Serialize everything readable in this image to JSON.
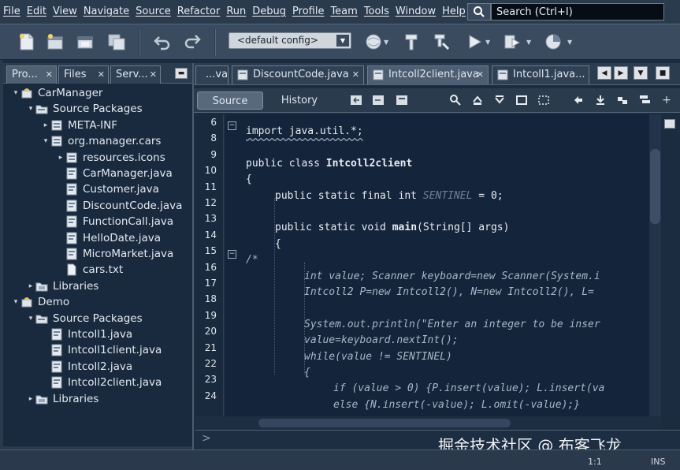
{
  "menu": [
    "File",
    "Edit",
    "View",
    "Navigate",
    "Source",
    "Refactor",
    "Run",
    "Debug",
    "Profile",
    "Team",
    "Tools",
    "Window",
    "Help"
  ],
  "search": {
    "placeholder": "Search (Ctrl+I)"
  },
  "toolbar": {
    "config": "<default config>",
    "icons": [
      "new-file-icon",
      "new-project-icon",
      "open-project-icon",
      "save-all-icon",
      "undo-icon",
      "redo-icon",
      "config-dropdown",
      "clean-build-icon",
      "build-hammer-icon",
      "clean-build-broom-icon",
      "run-icon",
      "debug-icon",
      "profile-icon"
    ]
  },
  "left_panel": {
    "tabs": [
      "Pro...",
      "Files",
      "Serv..."
    ],
    "tree": [
      {
        "label": "CarManager",
        "kind": "project",
        "expanded": true
      },
      {
        "label": "Source Packages",
        "kind": "source-folder",
        "expanded": true
      },
      {
        "label": "META-INF",
        "kind": "package",
        "expanded": false
      },
      {
        "label": "org.manager.cars",
        "kind": "package",
        "expanded": true
      },
      {
        "label": "resources.icons",
        "kind": "package",
        "expanded": false
      },
      {
        "label": "CarManager.java",
        "kind": "java-file"
      },
      {
        "label": "Customer.java",
        "kind": "java-file"
      },
      {
        "label": "DiscountCode.java",
        "kind": "java-file"
      },
      {
        "label": "FunctionCall.java",
        "kind": "java-file"
      },
      {
        "label": "HelloDate.java",
        "kind": "java-file"
      },
      {
        "label": "MicroMarket.java",
        "kind": "java-file"
      },
      {
        "label": "cars.txt",
        "kind": "text-file"
      },
      {
        "label": "Libraries",
        "kind": "libraries",
        "expanded": false
      },
      {
        "label": "Demo",
        "kind": "project",
        "expanded": true
      },
      {
        "label": "Source Packages",
        "kind": "source-folder",
        "expanded": true
      },
      {
        "label": "Intcoll1.java",
        "kind": "java-file"
      },
      {
        "label": "Intcoll1client.java",
        "kind": "java-file"
      },
      {
        "label": "Intcoll2.java",
        "kind": "java-file"
      },
      {
        "label": "Intcoll2client.java",
        "kind": "java-file"
      },
      {
        "label": "Libraries",
        "kind": "libraries",
        "expanded": false
      }
    ]
  },
  "editor": {
    "tabs": [
      {
        "label": "...va",
        "active": false
      },
      {
        "label": "DiscountCode.java",
        "active": false
      },
      {
        "label": "Intcoll2client.java",
        "active": true
      },
      {
        "label": "Intcoll1.java...",
        "active": false
      }
    ],
    "modes": [
      "Source",
      "History"
    ],
    "active_mode": "Source",
    "line_numbers": [
      "6",
      "8",
      "9",
      "10",
      "11",
      "12",
      "13",
      "14",
      "15",
      "16",
      "17",
      "18",
      "19",
      "20",
      "21",
      "22",
      "23",
      "24"
    ],
    "lines": [
      {
        "text": "import java.util.*;",
        "indent": 0
      },
      {
        "text": "",
        "indent": 0
      },
      {
        "text": "public class Intcoll2client",
        "indent": 0
      },
      {
        "text": "{",
        "indent": 0
      },
      {
        "text": "public static final int SENTINEL = 0;",
        "indent": 1
      },
      {
        "text": "",
        "indent": 0
      },
      {
        "text": "public static void main(String[] args)",
        "indent": 1
      },
      {
        "text": "{",
        "indent": 1
      },
      {
        "text": "/*",
        "indent": 0
      },
      {
        "text": "int value; Scanner keyboard=new Scanner(System.i",
        "indent": 2
      },
      {
        "text": "Intcoll2 P=new Intcoll2(), N=new Intcoll2(), L=",
        "indent": 2
      },
      {
        "text": "",
        "indent": 0
      },
      {
        "text": "System.out.println(\"Enter an integer to be inser",
        "indent": 2
      },
      {
        "text": "value=keyboard.nextInt();",
        "indent": 2
      },
      {
        "text": "while(value != SENTINEL)",
        "indent": 2
      },
      {
        "text": "{",
        "indent": 2
      },
      {
        "text": "if (value > 0) {P.insert(value); L.insert(va",
        "indent": 3
      },
      {
        "text": "else {N.insert(-value); L.omit(-value);}",
        "indent": 3
      }
    ]
  },
  "status": {
    "position": "1:1",
    "mode": "INS"
  },
  "watermark": "掘金技术社区 @ 布客飞龙"
}
